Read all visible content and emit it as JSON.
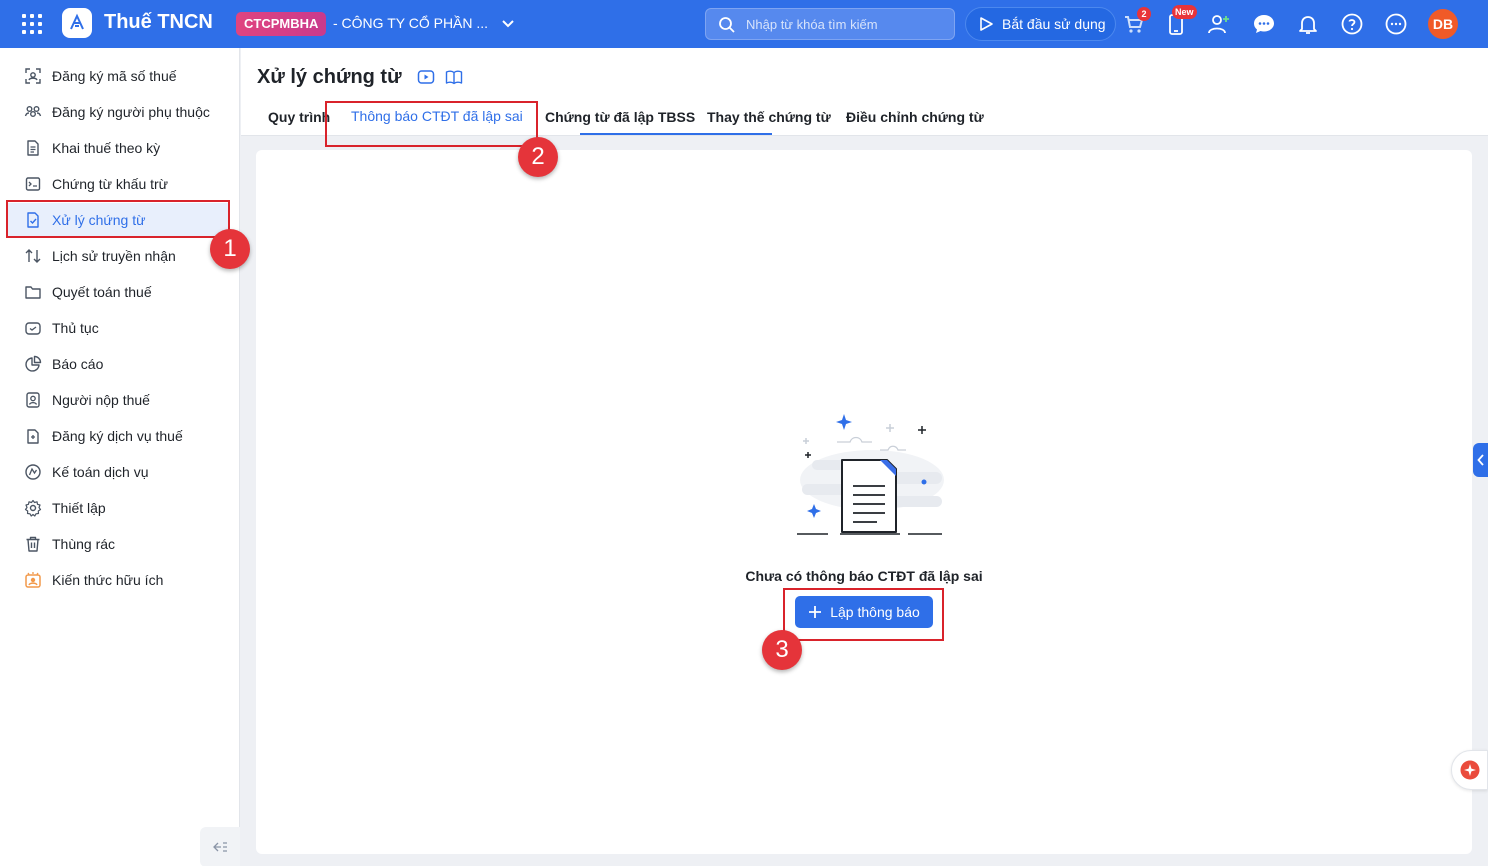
{
  "topbar": {
    "app_title": "Thuế TNCN",
    "company_code": "CTCPMBHA",
    "company_name": "- CÔNG TY CỔ PHẦN ...",
    "search_placeholder": "Nhập từ khóa tìm kiếm",
    "start_label": "Bắt đầu sử dụng",
    "cart_count": "2",
    "new_badge": "New",
    "avatar_initials": "DB",
    "accent_color": "#2f6fe8"
  },
  "sidebar": {
    "items": [
      {
        "label": "Đăng ký mã số thuế",
        "icon": "id-scan-icon"
      },
      {
        "label": "Đăng ký người phụ thuộc",
        "icon": "users-icon"
      },
      {
        "label": "Khai thuế theo kỳ",
        "icon": "document-icon"
      },
      {
        "label": "Chứng từ khấu trừ",
        "icon": "receipt-icon"
      },
      {
        "label": "Xử lý chứng từ",
        "icon": "document-check-icon"
      },
      {
        "label": "Lịch sử truyền nhận",
        "icon": "transfer-icon"
      },
      {
        "label": "Quyết toán thuế",
        "icon": "folder-icon"
      },
      {
        "label": "Thủ tục",
        "icon": "procedure-icon"
      },
      {
        "label": "Báo cáo",
        "icon": "pie-chart-icon"
      },
      {
        "label": "Người nộp thuế",
        "icon": "person-card-icon"
      },
      {
        "label": "Đăng ký dịch vụ thuế",
        "icon": "register-icon"
      },
      {
        "label": "Kế toán dịch vụ",
        "icon": "accounting-icon"
      },
      {
        "label": "Thiết lập",
        "icon": "gear-icon"
      },
      {
        "label": "Thùng rác",
        "icon": "trash-icon"
      },
      {
        "label": "Kiến thức hữu ích",
        "icon": "knowledge-icon"
      }
    ]
  },
  "page": {
    "title": "Xử lý chứng từ",
    "tabs": [
      {
        "label": "Quy trình"
      },
      {
        "label": "Thông báo CTĐT đã lập sai"
      },
      {
        "label": "Chứng từ đã lập TBSS"
      },
      {
        "label": "Thay thế chứng từ"
      },
      {
        "label": "Điều chỉnh chứng từ"
      }
    ],
    "empty_text": "Chưa có thông báo CTĐT đã lập sai",
    "create_label": "Lập thông báo"
  },
  "annotations": {
    "markers": [
      "1",
      "2",
      "3"
    ],
    "highlight_color": "#d9232b"
  }
}
